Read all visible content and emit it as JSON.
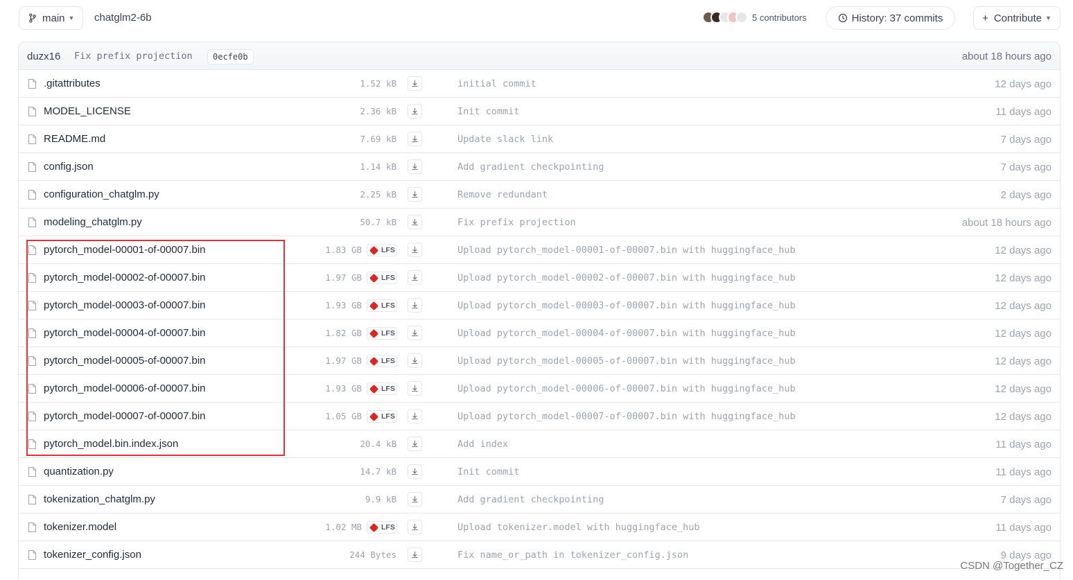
{
  "header": {
    "branch_label": "main",
    "repo_name": "chatglm2-6b",
    "contributors_label": "5 contributors",
    "history_label": "History: 37 commits",
    "contribute_label": "Contribute"
  },
  "last_commit": {
    "author": "duzx16",
    "message": "Fix prefix projection",
    "hash": "0ecfe0b",
    "time": "about 18 hours ago"
  },
  "files": [
    {
      "name": ".gitattributes",
      "size": "1.52 kB",
      "lfs": false,
      "message": "initial commit",
      "time": "12 days ago"
    },
    {
      "name": "MODEL_LICENSE",
      "size": "2.36 kB",
      "lfs": false,
      "message": "Init commit",
      "time": "11 days ago"
    },
    {
      "name": "README.md",
      "size": "7.69 kB",
      "lfs": false,
      "message": "Update slack link",
      "time": "7 days ago"
    },
    {
      "name": "config.json",
      "size": "1.14 kB",
      "lfs": false,
      "message": "Add gradient checkpointing",
      "time": "7 days ago"
    },
    {
      "name": "configuration_chatglm.py",
      "size": "2.25 kB",
      "lfs": false,
      "message": "Remove redundant",
      "time": "2 days ago"
    },
    {
      "name": "modeling_chatglm.py",
      "size": "50.7 kB",
      "lfs": false,
      "message": "Fix prefix projection",
      "time": "about 18 hours ago"
    },
    {
      "name": "pytorch_model-00001-of-00007.bin",
      "size": "1.83 GB",
      "lfs": true,
      "message": "Upload pytorch_model-00001-of-00007.bin with huggingface_hub",
      "time": "12 days ago"
    },
    {
      "name": "pytorch_model-00002-of-00007.bin",
      "size": "1.97 GB",
      "lfs": true,
      "message": "Upload pytorch_model-00002-of-00007.bin with huggingface_hub",
      "time": "12 days ago"
    },
    {
      "name": "pytorch_model-00003-of-00007.bin",
      "size": "1.93 GB",
      "lfs": true,
      "message": "Upload pytorch_model-00003-of-00007.bin with huggingface_hub",
      "time": "12 days ago"
    },
    {
      "name": "pytorch_model-00004-of-00007.bin",
      "size": "1.82 GB",
      "lfs": true,
      "message": "Upload pytorch_model-00004-of-00007.bin with huggingface_hub",
      "time": "12 days ago"
    },
    {
      "name": "pytorch_model-00005-of-00007.bin",
      "size": "1.97 GB",
      "lfs": true,
      "message": "Upload pytorch_model-00005-of-00007.bin with huggingface_hub",
      "time": "12 days ago"
    },
    {
      "name": "pytorch_model-00006-of-00007.bin",
      "size": "1.93 GB",
      "lfs": true,
      "message": "Upload pytorch_model-00006-of-00007.bin with huggingface_hub",
      "time": "12 days ago"
    },
    {
      "name": "pytorch_model-00007-of-00007.bin",
      "size": "1.05 GB",
      "lfs": true,
      "message": "Upload pytorch_model-00007-of-00007.bin with huggingface_hub",
      "time": "12 days ago"
    },
    {
      "name": "pytorch_model.bin.index.json",
      "size": "20.4 kB",
      "lfs": false,
      "message": "Add index",
      "time": "11 days ago"
    },
    {
      "name": "quantization.py",
      "size": "14.7 kB",
      "lfs": false,
      "message": "Init commit",
      "time": "11 days ago"
    },
    {
      "name": "tokenization_chatglm.py",
      "size": "9.9 kB",
      "lfs": false,
      "message": "Add gradient checkpointing",
      "time": "7 days ago"
    },
    {
      "name": "tokenizer.model",
      "size": "1.02 MB",
      "lfs": true,
      "message": "Upload tokenizer.model with huggingface_hub",
      "time": "11 days ago"
    },
    {
      "name": "tokenizer_config.json",
      "size": "244 Bytes",
      "lfs": false,
      "message": "Fix name_or_path in tokenizer_config.json",
      "time": "9 days ago"
    }
  ],
  "lfs_label": "LFS",
  "watermark": "CSDN @Together_CZ",
  "colors": {
    "highlight": "#e0303a",
    "lfs_icon": "#dc2626",
    "border": "#e5e7eb"
  },
  "icons": {
    "branch": "branch-icon",
    "history": "clock-icon",
    "file": "file-icon",
    "download": "download-icon",
    "lfs": "lfs-cube-icon"
  }
}
